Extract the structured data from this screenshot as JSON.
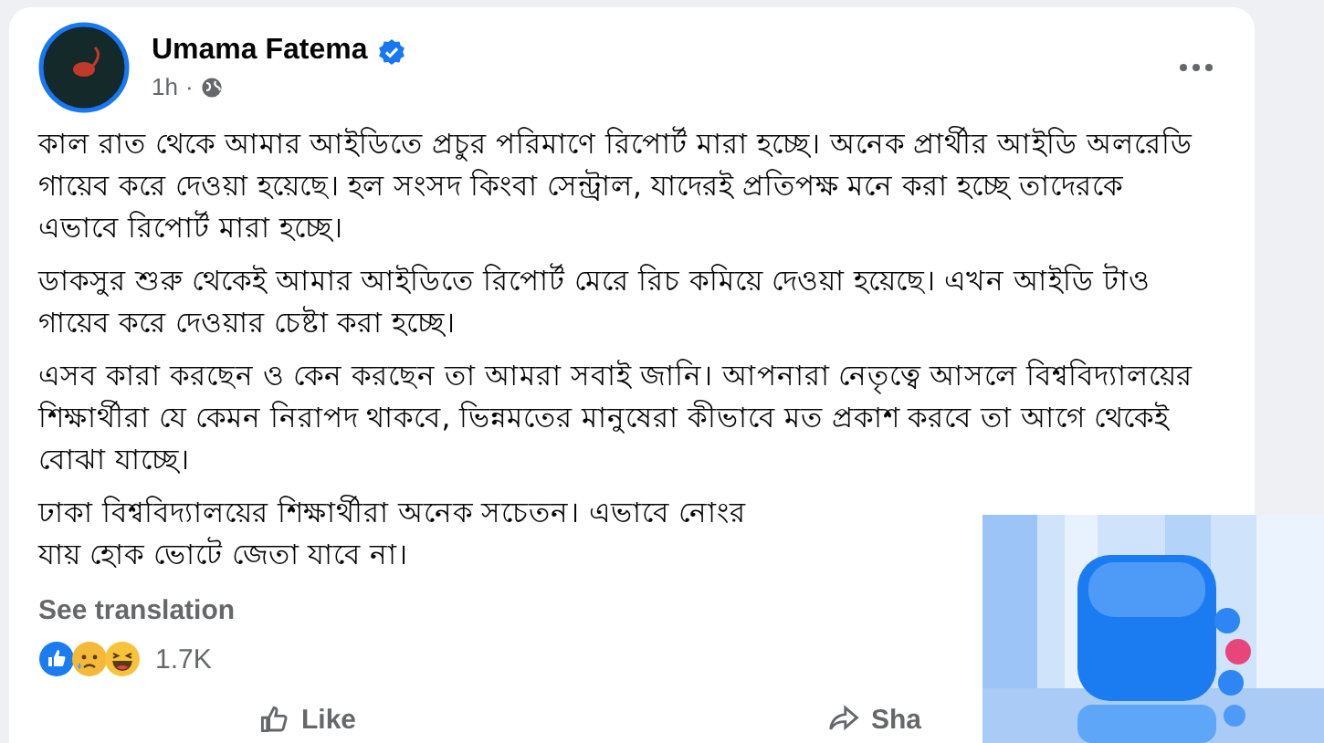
{
  "post": {
    "author": "Umama Fatema",
    "verified": true,
    "time": "1h",
    "separator": "·",
    "paragraphs": [
      [
        "কাল রাত থেকে আমার আইডিতে প্রচুর পরিমাণে রিপোর্ট মারা হচ্ছে। অনেক প্রার্থীর আইডি অলরেডি গায়েব করে দেওয়া হয়েছে। হল সংসদ কিংবা সেন্ট্রাল, যাদেরই প্রতিপক্ষ মনে করা হচ্ছে তাদেরকে এভাবে রিপোর্ট মারা হচ্ছে।"
      ],
      [
        "ডাকসুর শুরু থেকেই আমার আইডিতে রিপোর্ট মেরে রিচ কমিয়ে দেওয়া হয়েছে। এখন আইডি টাও গায়েব করে দেওয়ার চেষ্টা করা হচ্ছে।"
      ],
      [
        "এসব কারা করছেন ও কেন করছেন তা আমরা সবাই জানি। আপনারা নেতৃত্বে আসলে বিশ্ববিদ্যালয়ের শিক্ষার্থীরা যে কেমন নিরাপদ থাকবে, ভিন্নমতের মানুষেরা কীভাবে মত প্রকাশ করবে তা আগে থেকেই বোঝা যাচ্ছে।"
      ],
      [
        "ঢাকা বিশ্ববিদ্যালয়ের শিক্ষার্থীরা অনেক সচেতন। এভাবে নোংর",
        "যায় হোক ভোটে জেতা যাবে না।"
      ]
    ],
    "see_translation": "See translation",
    "reactions": [
      {
        "kind": "like"
      },
      {
        "kind": "sad"
      },
      {
        "kind": "haha"
      }
    ],
    "reaction_count": "1.7K",
    "actions": [
      {
        "kind": "like",
        "label": "Like"
      },
      {
        "kind": "share",
        "label": "Sha"
      }
    ]
  }
}
